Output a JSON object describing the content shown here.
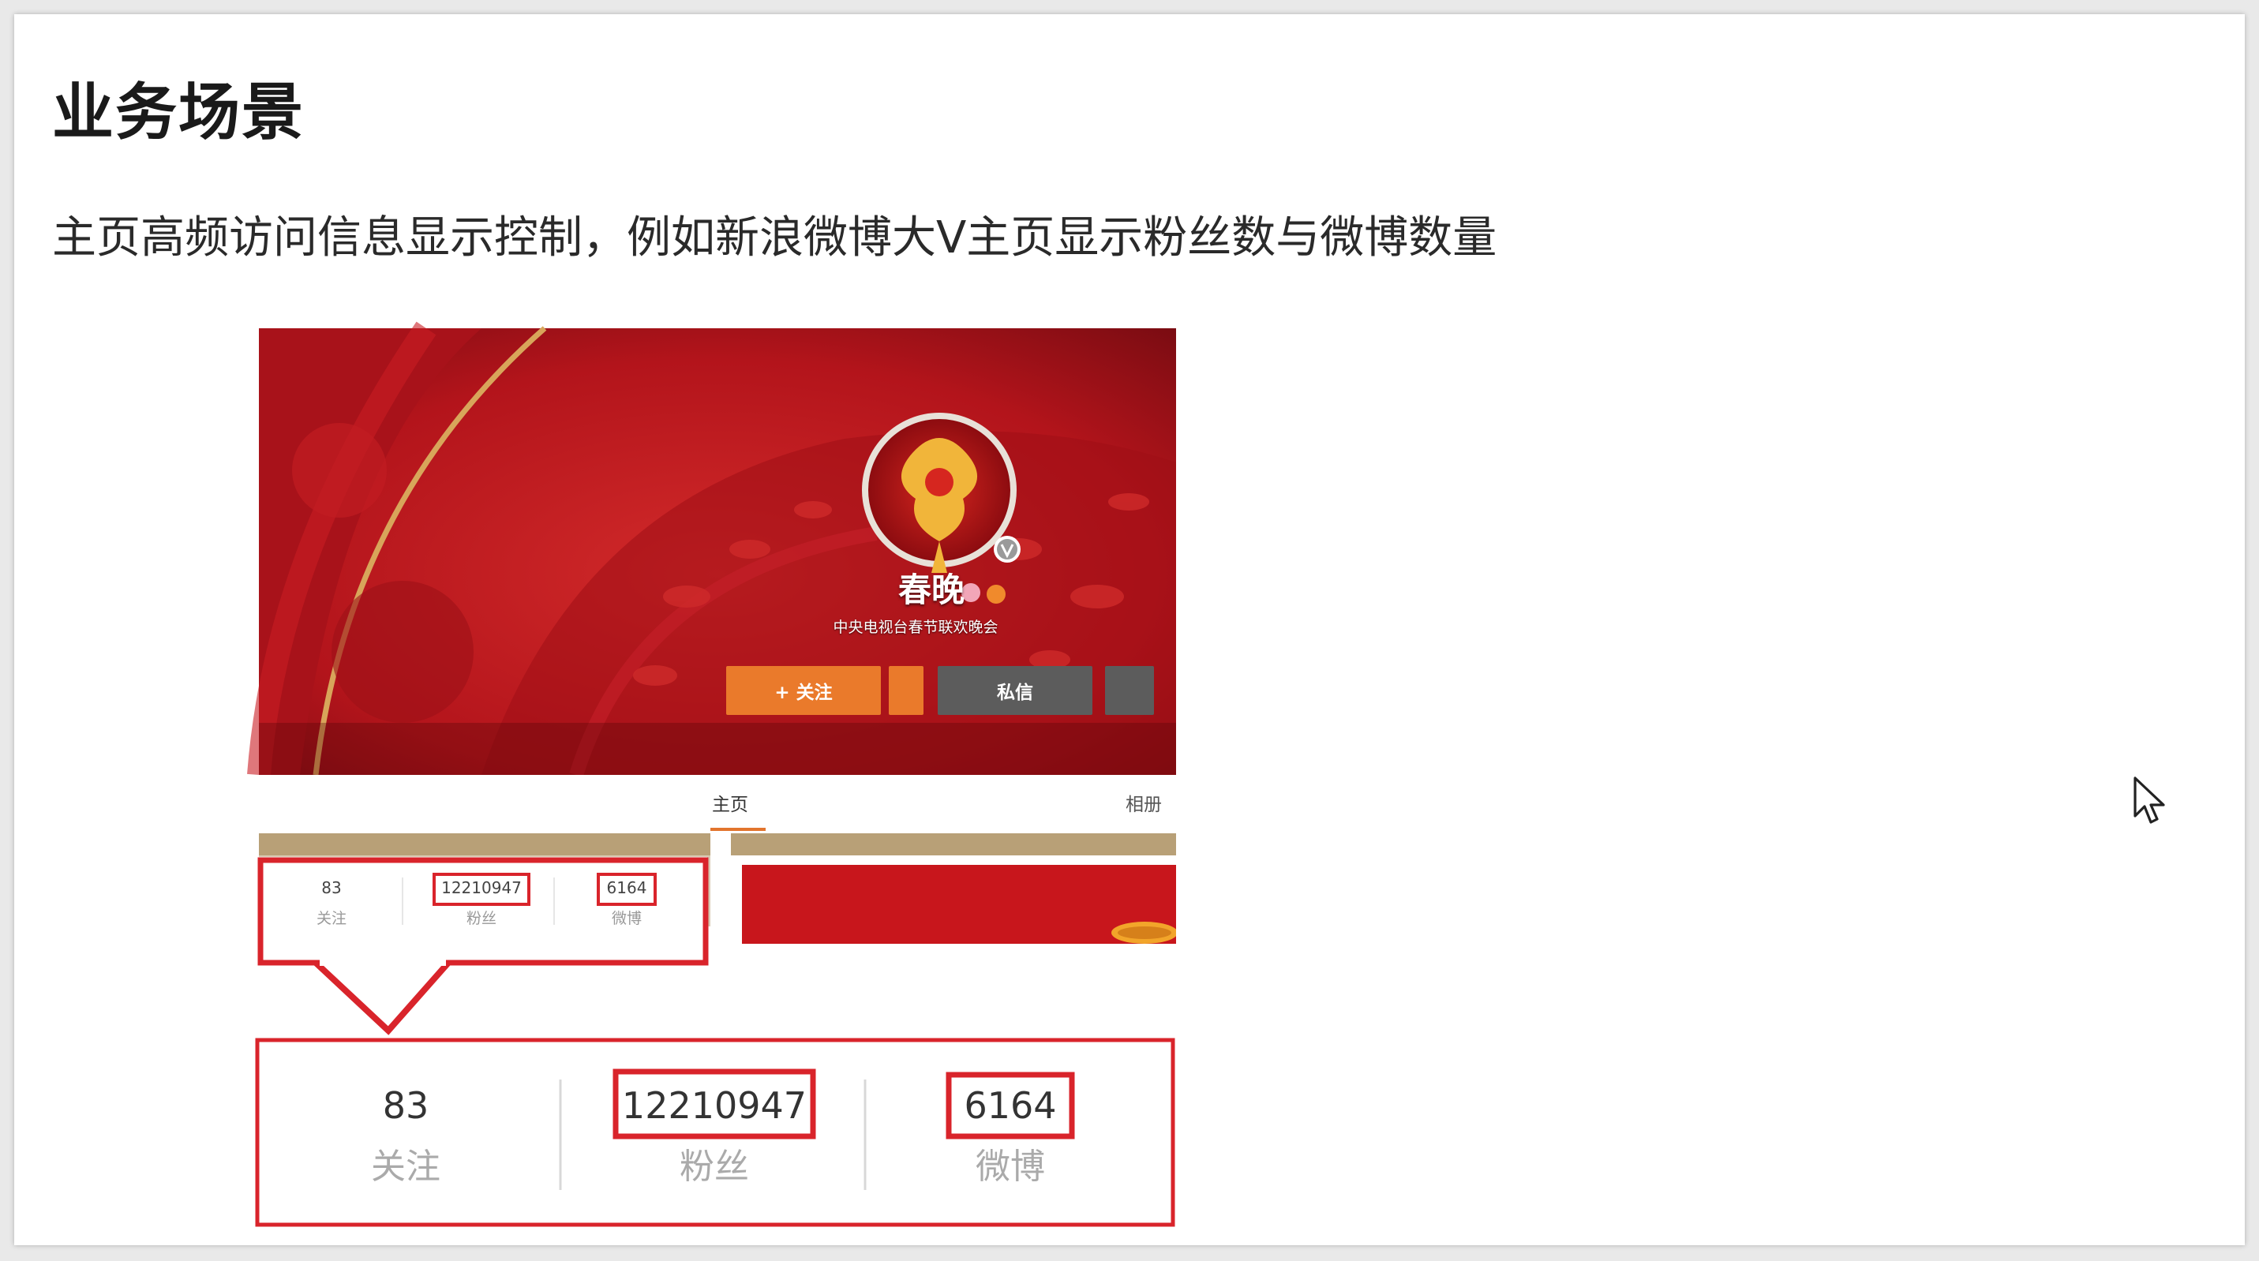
{
  "slide": {
    "title": "业务场景",
    "description": "主页高频访问信息显示控制，例如新浪微博大V主页显示粉丝数与微博数量"
  },
  "profile": {
    "name": "春晚",
    "subtitle": "中央电视台春节联欢晚会",
    "follow_button": "+ 关注",
    "message_button": "私信",
    "tabs": [
      "主页",
      "相册"
    ]
  },
  "stats": [
    {
      "value": "83",
      "label": "关注"
    },
    {
      "value": "12210947",
      "label": "粉丝"
    },
    {
      "value": "6164",
      "label": "微博"
    }
  ],
  "colors": {
    "highlight_red": "#d9242b",
    "follow_orange": "#ea7a2b",
    "banner_red": "#b5141c",
    "tab_strip": "#b8a077"
  }
}
